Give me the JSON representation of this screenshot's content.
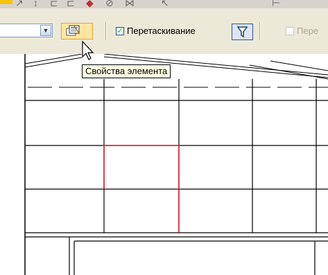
{
  "toolbar": {
    "drag_checkbox": {
      "label": "Перетаскивание",
      "checked": true
    },
    "second_checkbox": {
      "label": "Пере",
      "checked": false,
      "enabled": false
    },
    "properties_button": {
      "icon": "properties-icon"
    },
    "filter_button": {
      "icon": "filter-icon"
    }
  },
  "tooltip": {
    "text": "Свойства элемента"
  },
  "drawing": {
    "highlight_color": "#e02020"
  },
  "colors": {
    "toolbar_bg": "#ece9d8",
    "hover_button": "#ffe6a0",
    "accent_blue": "#32568b"
  }
}
